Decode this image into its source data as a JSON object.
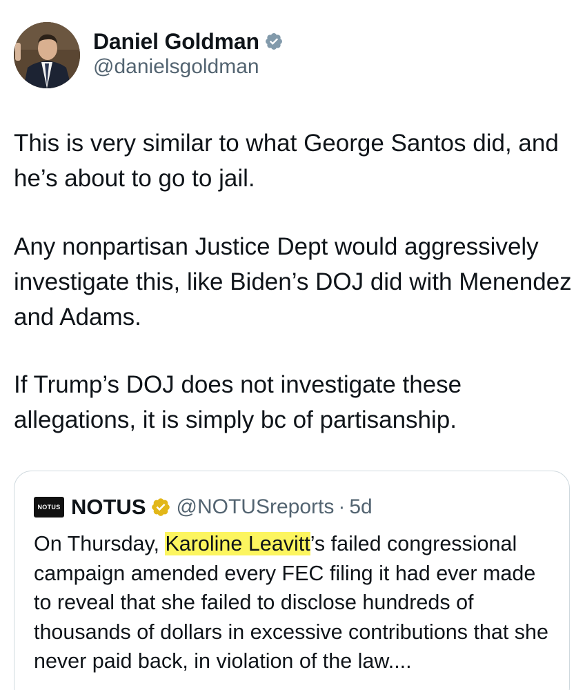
{
  "author": {
    "display_name": "Daniel Goldman",
    "handle": "@danielsgoldman",
    "verified_icon": "verified-badge-icon",
    "badge_color": "#829aab"
  },
  "tweet": {
    "paragraphs": [
      "This is very similar to what George Santos did, and he’s about to go to jail.",
      "Any nonpartisan Justice Dept would aggressively investigate this, like  Biden’s DOJ did with Menendez and Adams.",
      "If Trump’s DOJ does not investigate these allegations, it is simply bc of partisanship."
    ]
  },
  "quoted_tweet": {
    "avatar_text": "NOTUS",
    "display_name": "NOTUS",
    "badge_icon": "gold-verified-badge-icon",
    "badge_color": "#e2b719",
    "handle": "@NOTUSreports",
    "separator": "·",
    "time": "5d",
    "text_before": "On Thursday, ",
    "text_highlight": "Karoline Leavitt",
    "text_after": "’s failed congressional campaign amended every FEC filing it had ever made to reveal that she failed to disclose hundreds of thousands of dollars in excessive contributions that she never paid back, in violation of the law....",
    "highlight_color": "#fcf55f"
  }
}
